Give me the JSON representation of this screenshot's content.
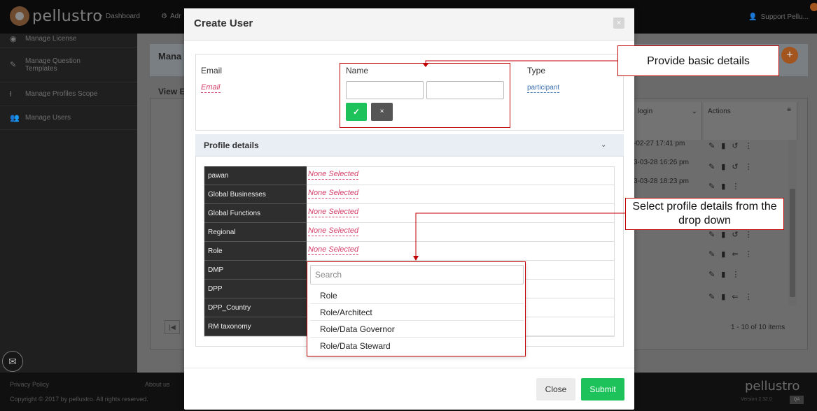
{
  "app": {
    "logo_text": "pellustro",
    "nav": {
      "dashboard": "Dashboard",
      "admin": "Adr"
    },
    "user_label": "Support Pellu..."
  },
  "sidebar": {
    "items": [
      {
        "label": "Manage License",
        "icon": "license-icon"
      },
      {
        "label": "Manage Question Templates",
        "icon": "pencil-icon"
      },
      {
        "label": "Manage Profiles Scope",
        "icon": "scope-icon"
      },
      {
        "label": "Manage Users",
        "icon": "users-icon"
      }
    ]
  },
  "page": {
    "title": "Mana",
    "view_label": "View E",
    "grid": {
      "col_login": "login",
      "col_actions": "Actions",
      "rows": [
        "-02-27 17:41 pm",
        "3-03-28 16:26 pm",
        "3-03-28 18:23 pm"
      ],
      "items_count": "1 - 10 of 10 items"
    }
  },
  "footer": {
    "privacy": "Privacy Policy",
    "about": "About us",
    "copyright": "Copyright © 2017 by pellustro. All rights reserved.",
    "logo_text": "pellustro",
    "version": "Version 2.32.0",
    "env": "QA"
  },
  "modal": {
    "title": "Create User",
    "close_x": "×",
    "email_label": "Email",
    "email_value": "Email",
    "name_label": "Name",
    "type_label": "Type",
    "type_value": "participant",
    "confirm_icon": "✓",
    "cancel_icon": "×",
    "profile_section_title": "Profile details",
    "profile_rows": [
      {
        "key": "pawan",
        "value": "None Selected"
      },
      {
        "key": "Global Businesses",
        "value": "None Selected"
      },
      {
        "key": "Global Functions",
        "value": "None Selected"
      },
      {
        "key": "Regional",
        "value": "None Selected"
      },
      {
        "key": "Role",
        "value": "None Selected"
      },
      {
        "key": "DMP",
        "value": ""
      },
      {
        "key": "DPP",
        "value": ""
      },
      {
        "key": "DPP_Country",
        "value": ""
      },
      {
        "key": "RM taxonomy",
        "value": ""
      }
    ],
    "dropdown": {
      "search_placeholder": "Search",
      "options": [
        "Role",
        "Role/Architect",
        "Role/Data Governor",
        "Role/Data Steward"
      ]
    },
    "close_button": "Close",
    "submit_button": "Submit"
  },
  "annotations": {
    "basic": "Provide basic details",
    "profile": "Select profile details from the drop down"
  },
  "colors": {
    "accent_green": "#1ec25a",
    "link_red": "#d43f6a",
    "annotation_red": "#c00000",
    "brand_orange": "#e07b2e"
  }
}
